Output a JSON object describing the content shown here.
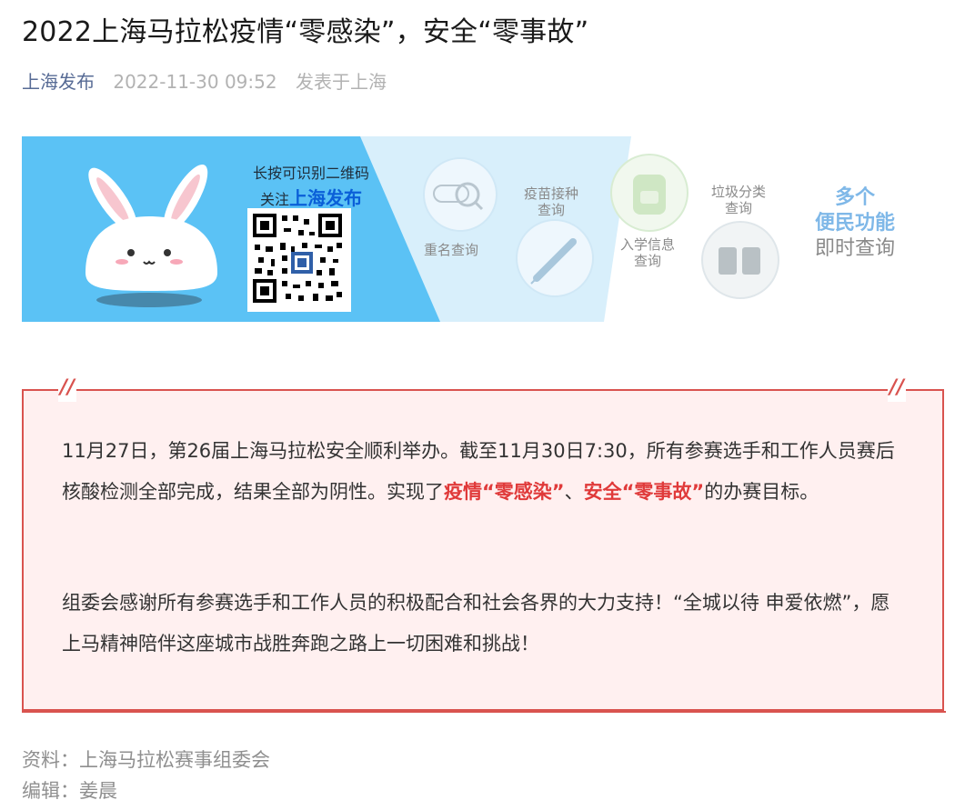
{
  "article": {
    "title": "2022上海马拉松疫情“零感染”，安全“零事故”",
    "account": "上海发布",
    "date": "2022-11-30 09:52",
    "location": "发表于上海"
  },
  "banner": {
    "qr_hint": "长按可识别二维码",
    "follow_prefix": "关注",
    "follow_name": "上海发布",
    "services": [
      {
        "label": "重名查询",
        "icon": "name-search-icon"
      },
      {
        "label": "疫苗接种查询",
        "icon": "syringe-icon"
      },
      {
        "label": "入学信息查询",
        "icon": "backpack-icon"
      },
      {
        "label": "垃圾分类查询",
        "icon": "trash-bin-icon"
      }
    ],
    "multi_line1": "多个",
    "multi_line2": "便民功能",
    "multi_line3": "即时查询",
    "colors": {
      "left_bg": "#5bc2f5",
      "right_bg": "#d8effb",
      "accent": "#0a5fd8"
    }
  },
  "notice": {
    "p1_a": "11月27日，第26届上海马拉松安全顺利举办。截至11月30日7:30，所有参赛选手和工作人员赛后核酸检测全部完成，结果全部为阴性。实现了",
    "p1_hl1": "疫情“零感染”",
    "p1_sep": "、",
    "p1_hl2": "安全“零事故”",
    "p1_b": "的办赛目标。",
    "p2": "组委会感谢所有参赛选手和工作人员的积极配合和社会各界的大力支持！“全城以待 申爱依燃”，愿上马精神陪伴这座城市战胜奔跑之路上一切困难和挑战！",
    "highlight_color": "#e03a3a",
    "border_color": "#d9534f"
  },
  "footer": {
    "source": "资料：上海马拉松赛事组委会",
    "editor": "编辑：姜晨"
  }
}
